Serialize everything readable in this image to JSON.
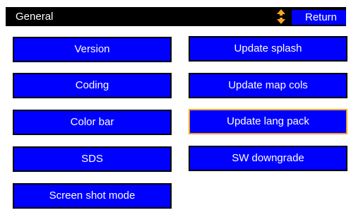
{
  "header": {
    "title": "General",
    "return_label": "Return",
    "scroll_icon": "up-down-arrows-icon",
    "scroll_icon_color": "#f5a623"
  },
  "menu": {
    "left": [
      {
        "label": "Version"
      },
      {
        "label": "Coding"
      },
      {
        "label": "Color bar"
      },
      {
        "label": "SDS"
      },
      {
        "label": "Screen shot mode"
      }
    ],
    "right": [
      {
        "label": "Update splash"
      },
      {
        "label": "Update map cols"
      },
      {
        "label": "Update lang pack",
        "selected": true
      },
      {
        "label": "SW downgrade"
      }
    ]
  },
  "colors": {
    "button_fill": "#0000ff",
    "button_border": "#000000",
    "selected_border": "#f5a623",
    "header_bg": "#000000",
    "text": "#ffffff"
  }
}
